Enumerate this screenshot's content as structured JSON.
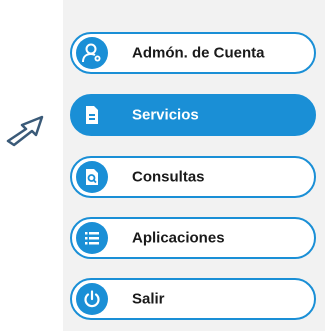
{
  "menu": {
    "items": [
      {
        "label": "Admón. de Cuenta",
        "icon": "account-admin-icon",
        "active": false
      },
      {
        "label": "Servicios",
        "icon": "document-icon",
        "active": true
      },
      {
        "label": "Consultas",
        "icon": "search-icon",
        "active": false
      },
      {
        "label": "Aplicaciones",
        "icon": "list-icon",
        "active": false
      },
      {
        "label": "Salir",
        "icon": "power-icon",
        "active": false
      }
    ]
  },
  "colors": {
    "accent": "#1a8fd6",
    "panel_background": "#f2f2f2",
    "text": "#1a1a1a",
    "active_text": "#ffffff"
  },
  "pointer": {
    "icon": "arrow-pointer-icon"
  }
}
